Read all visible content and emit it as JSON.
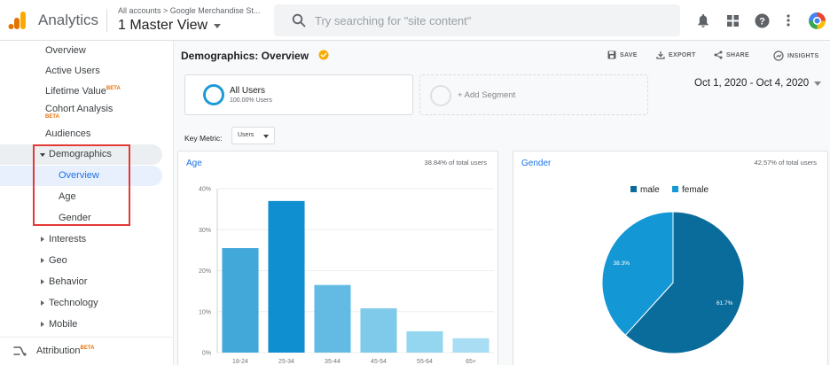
{
  "header": {
    "app_name": "Analytics",
    "account_path": "All accounts > Google Merchandise St...",
    "view_name": "1 Master View",
    "search_placeholder": "Try searching for \"site content\""
  },
  "sidebar": {
    "items": [
      {
        "label": "Overview"
      },
      {
        "label": "Active Users"
      },
      {
        "label": "Lifetime Value",
        "badge": "BETA"
      },
      {
        "label": "Cohort Analysis",
        "badge": "BETA"
      },
      {
        "label": "Audiences"
      },
      {
        "label": "Demographics"
      },
      {
        "label": "Overview"
      },
      {
        "label": "Age"
      },
      {
        "label": "Gender"
      },
      {
        "label": "Interests"
      },
      {
        "label": "Geo"
      },
      {
        "label": "Behavior"
      },
      {
        "label": "Technology"
      },
      {
        "label": "Mobile"
      }
    ],
    "attribution": {
      "label": "Attribution",
      "badge": "BETA"
    }
  },
  "main": {
    "title": "Demographics: Overview",
    "actions": {
      "save": "SAVE",
      "export": "EXPORT",
      "share": "SHARE",
      "insights": "INSIGHTS"
    },
    "segment": {
      "name": "All Users",
      "pct": "100.00% Users"
    },
    "add_segment": "+ Add Segment",
    "date_range": "Oct 1, 2020 - Oct 4, 2020",
    "key_metric_label": "Key Metric:",
    "key_metric_value": "Users",
    "age_card": {
      "title": "Age",
      "subtitle": "38.84% of total users"
    },
    "gender_card": {
      "title": "Gender",
      "subtitle": "42.57% of total users"
    }
  },
  "colors": {
    "bar_colors": [
      "#42a7d9",
      "#0f8fd0",
      "#63bbe3",
      "#7fcaea",
      "#94d5f0",
      "#a9ddf3"
    ],
    "male": "#0a6c9b",
    "female": "#1498d5"
  },
  "chart_data": [
    {
      "type": "bar",
      "categories": [
        "18-24",
        "25-34",
        "35-44",
        "45-54",
        "55-64",
        "65+"
      ],
      "values": [
        25.5,
        37,
        16.5,
        10.8,
        5.2,
        3.5
      ],
      "ylim": [
        0,
        40
      ],
      "yticks": [
        "0%",
        "10%",
        "20%",
        "30%",
        "40%"
      ],
      "grid": true
    },
    {
      "type": "pie",
      "labels": [
        "male",
        "female"
      ],
      "values": [
        61.7,
        38.3
      ],
      "value_labels": [
        "61.7%",
        "38.3%"
      ],
      "legend": "top"
    }
  ]
}
